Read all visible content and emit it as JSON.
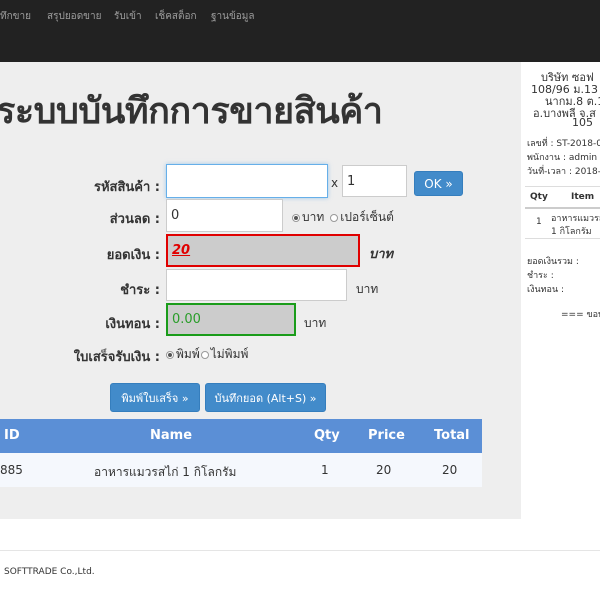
{
  "nav": {
    "items": [
      "ทึกขาย",
      "สรุปยอดขาย",
      "รับเข้า",
      "เช็คสต็อก",
      "ฐานข้อมูล"
    ]
  },
  "page": {
    "title": "ระบบบันทึกการขายสินค้า"
  },
  "form": {
    "product_code_label": "รหัสสินค้า :",
    "product_code_value": "",
    "multiply": "x",
    "qty_value": "1",
    "ok_button": "OK »",
    "discount_label": "ส่วนลด :",
    "discount_value": "0",
    "discount_unit_baht": "บาท",
    "discount_unit_percent": "เปอร์เซ็นต์",
    "total_label": "ยอดเงิน :",
    "total_value": "20",
    "total_unit": "บาท",
    "pay_label": "ชำระ :",
    "pay_value": "",
    "pay_unit": "บาท",
    "change_label": "เงินทอน :",
    "change_value": "0.00",
    "change_unit": "บาท",
    "receipt_label": "ใบเสร็จรับเงิน :",
    "receipt_print": "พิมพ์",
    "receipt_no_print": "ไม่พิมพ์"
  },
  "buttons": {
    "print_receipt": "พิมพ์ใบเสร็จ »",
    "save_total": "บันทึกยอด (Alt+S) »"
  },
  "table": {
    "headers": [
      "ID",
      "Name",
      "Qty",
      "Price",
      "Total"
    ],
    "rows": [
      {
        "id": "885",
        "name": "อาหารแมวรสไก่ 1 กิโลกรัม",
        "qty": "1",
        "price": "20",
        "total": "20"
      }
    ]
  },
  "receipt": {
    "company": "บริษัท ซอฟ",
    "address1": "108/96 ม.13 เ",
    "address2": "นากม.8 ต.1",
    "address3": "อ.บางพลี จ.ส",
    "address4": "105",
    "doc_no": "เลขที่ : ST-2018-0",
    "staff": "พนักงาน : admin",
    "datetime": "วันที่-เวลา : 2018-0",
    "col_qty": "Qty",
    "col_item": "Item",
    "item_qty": "1",
    "item_name1": "อาหารแมวรส",
    "item_name2": "1 กิโลกรัม",
    "sum_label": "ยอดเงินรวม :",
    "pay_label": "ชำระ :",
    "change_label": "เงินทอน :",
    "thanks": "=== ขอบค"
  },
  "footer": {
    "text": "SOFTTRADE Co.,Ltd."
  },
  "colors": {
    "navbar": "#222222",
    "primary": "#428bca",
    "table_head": "#5b8fd6",
    "error_border": "#e00000",
    "success_border": "#1a9c1a"
  }
}
